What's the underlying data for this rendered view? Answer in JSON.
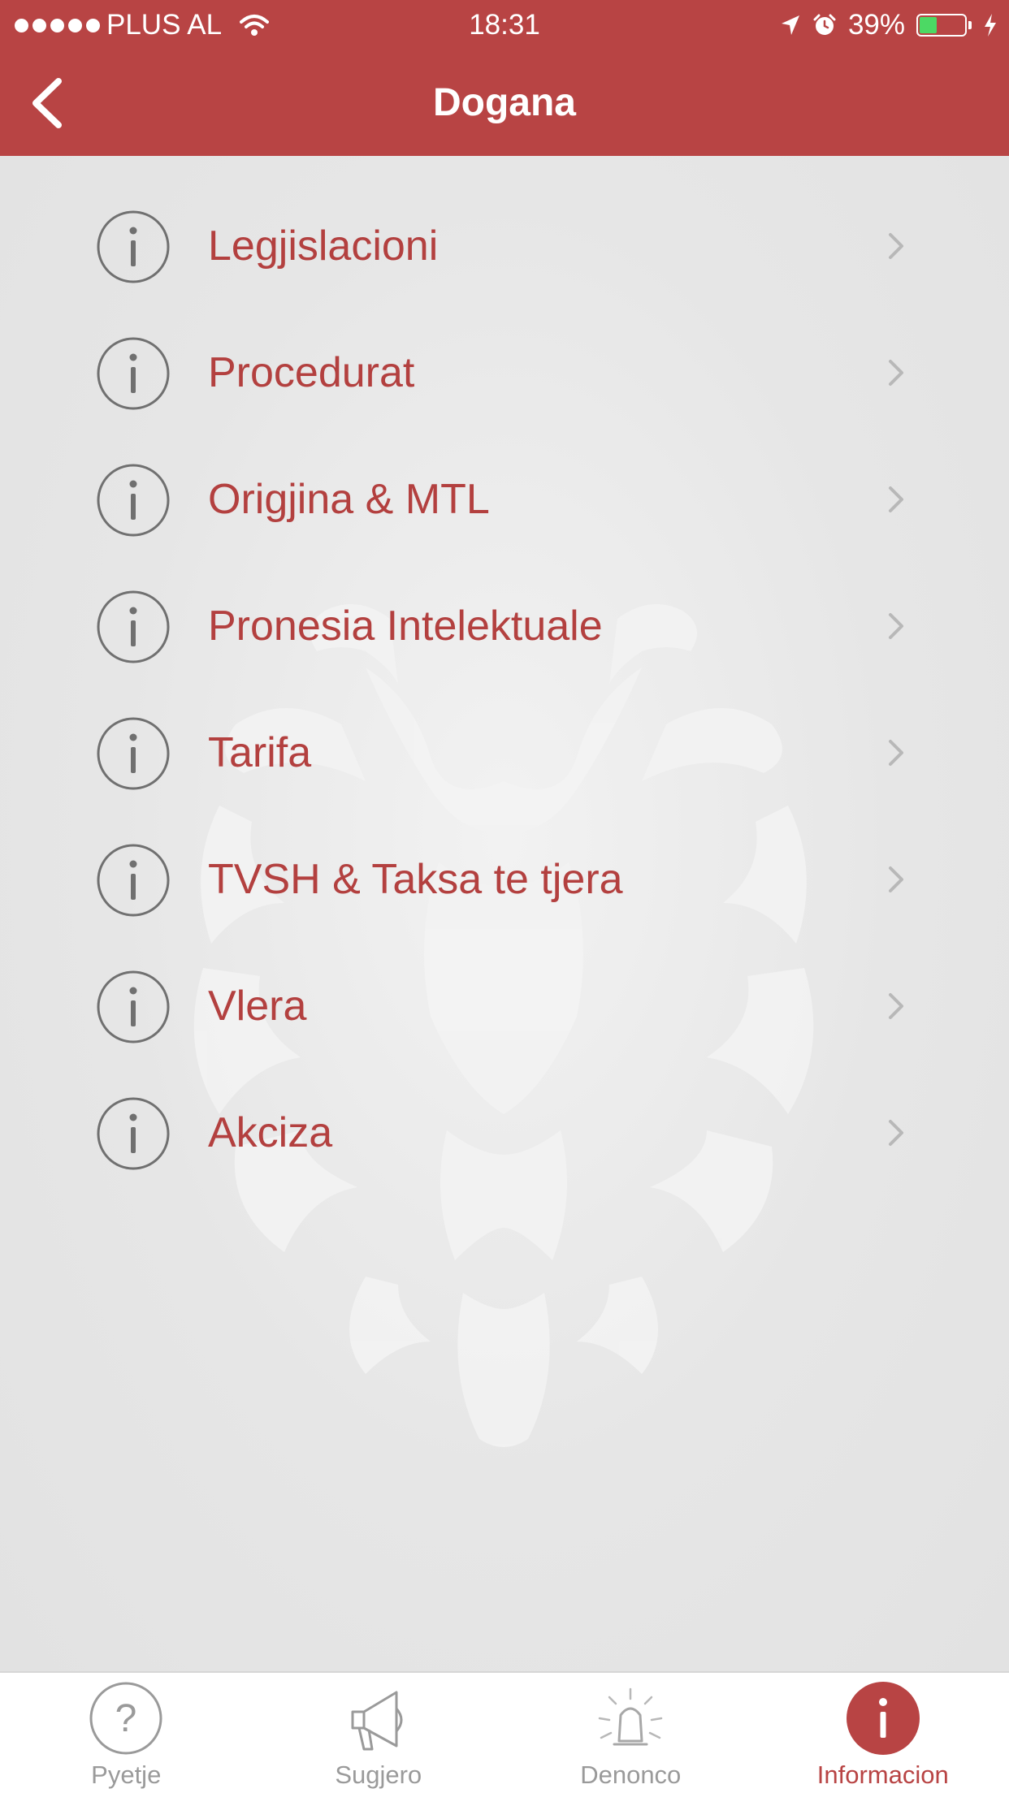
{
  "status_bar": {
    "carrier": "PLUS AL",
    "time": "18:31",
    "battery": "39%",
    "battery_level": 0.39
  },
  "nav": {
    "title": "Dogana",
    "back_icon": "chevron-left-icon"
  },
  "menu": {
    "items": [
      {
        "label": "Legjislacioni",
        "icon": "info-circle-icon"
      },
      {
        "label": "Procedurat",
        "icon": "info-circle-icon"
      },
      {
        "label": "Origjina & MTL",
        "icon": "info-circle-icon"
      },
      {
        "label": "Pronesia Intelektuale",
        "icon": "info-circle-icon"
      },
      {
        "label": "Tarifa",
        "icon": "info-circle-icon"
      },
      {
        "label": "TVSH & Taksa te tjera",
        "icon": "info-circle-icon"
      },
      {
        "label": "Vlera",
        "icon": "info-circle-icon"
      },
      {
        "label": "Akciza",
        "icon": "info-circle-icon"
      }
    ]
  },
  "tabbar": {
    "tabs": [
      {
        "label": "Pyetje",
        "icon": "question-circle-icon",
        "active": false
      },
      {
        "label": "Sugjero",
        "icon": "megaphone-icon",
        "active": false
      },
      {
        "label": "Denonco",
        "icon": "alarm-bell-icon",
        "active": false
      },
      {
        "label": "Informacion",
        "icon": "info-circle-icon",
        "active": true
      }
    ]
  },
  "colors": {
    "brand_red": "#b84444",
    "label_red": "#b3403f",
    "background": "#e4e4e4",
    "inactive_tab": "#9a9a9a"
  }
}
